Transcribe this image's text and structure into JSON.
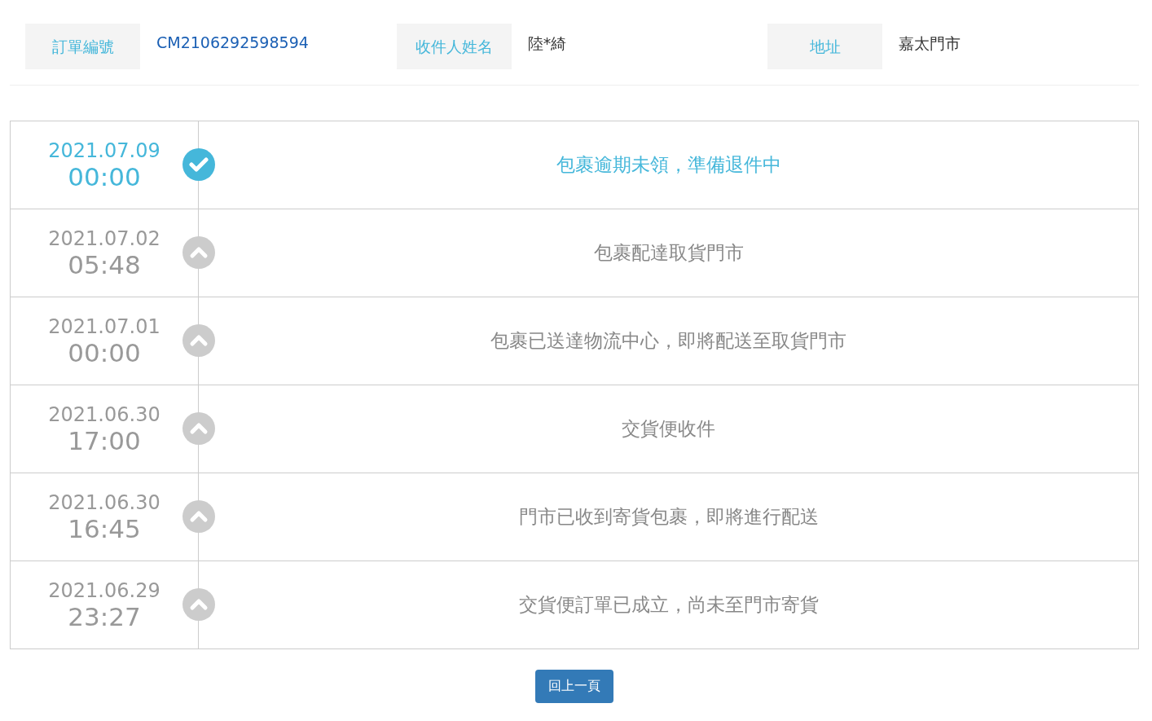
{
  "order_info": [
    {
      "label": "訂單編號",
      "value": "CM2106292598594",
      "kind": "link"
    },
    {
      "label": "收件人姓名",
      "value": "陸*綺",
      "kind": "text"
    },
    {
      "label": "地址",
      "value": "嘉太門市",
      "kind": "text"
    }
  ],
  "events": [
    {
      "date": "2021.07.09",
      "time": "00:00",
      "status": "包裹逾期未領，準備退件中",
      "latest": true
    },
    {
      "date": "2021.07.02",
      "time": "05:48",
      "status": "包裹配達取貨門市",
      "latest": false
    },
    {
      "date": "2021.07.01",
      "time": "00:00",
      "status": "包裹已送達物流中心，即將配送至取貨門市",
      "latest": false
    },
    {
      "date": "2021.06.30",
      "time": "17:00",
      "status": "交貨便收件",
      "latest": false
    },
    {
      "date": "2021.06.30",
      "time": "16:45",
      "status": "門市已收到寄貨包裹，即將進行配送",
      "latest": false
    },
    {
      "date": "2021.06.29",
      "time": "23:27",
      "status": "交貨便訂單已成立，尚未至門市寄貨",
      "latest": false
    }
  ],
  "back_button": "回上一頁"
}
